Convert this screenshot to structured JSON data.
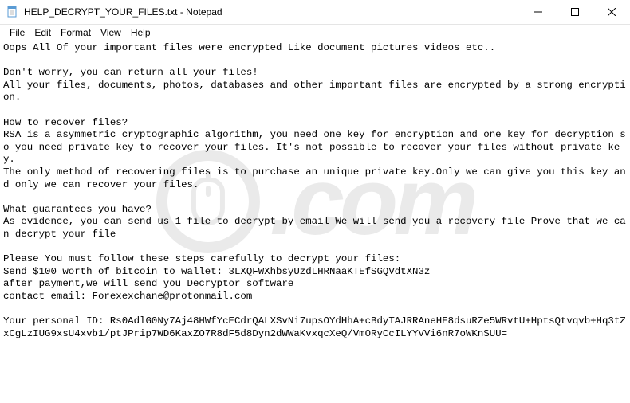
{
  "titlebar": {
    "title": "HELP_DECRYPT_YOUR_FILES.txt - Notepad"
  },
  "menubar": {
    "file": "File",
    "edit": "Edit",
    "format": "Format",
    "view": "View",
    "help": "Help"
  },
  "content": {
    "text": "Oops All Of your important files were encrypted Like document pictures videos etc..\n\nDon't worry, you can return all your files!\nAll your files, documents, photos, databases and other important files are encrypted by a strong encryption.\n\nHow to recover files?\nRSA is a asymmetric cryptographic algorithm, you need one key for encryption and one key for decryption so you need private key to recover your files. It's not possible to recover your files without private key.\nThe only method of recovering files is to purchase an unique private key.Only we can give you this key and only we can recover your files.\n\nWhat guarantees you have?\nAs evidence, you can send us 1 file to decrypt by email We will send you a recovery file Prove that we can decrypt your file\n\nPlease You must follow these steps carefully to decrypt your files:\nSend $100 worth of bitcoin to wallet: 3LXQFWXhbsyUzdLHRNaaKTEfSGQVdtXN3z\nafter payment,we will send you Decryptor software\ncontact email: Forexexchane@protonmail.com\n\nYour personal ID: Rs0AdlG0Ny7Aj48HWfYcECdrQALXSvNi7upsOYdHhA+cBdyTAJRRAneHE8dsuRZe5WRvtU+HptsQtvqvb+Hq3tZxCgLzIUG9xsU4xvb1/ptJPrip7WD6KaxZO7R8dF5d8Dyn2dWWaKvxqcXeQ/VmORyCcILYYVVi6nR7oWKnSUU="
  },
  "watermark": {
    "text": ".com"
  }
}
